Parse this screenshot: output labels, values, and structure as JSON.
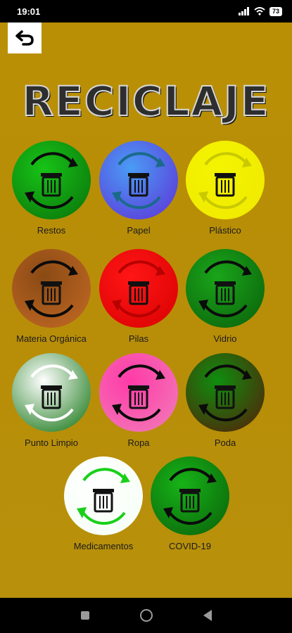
{
  "status_bar": {
    "time": "19:01",
    "battery": "73"
  },
  "header": {
    "title": "RECICLAJE"
  },
  "categories": [
    {
      "label": "Restos",
      "colors": [
        "#17c317",
        "#0a6f0a"
      ],
      "ring": "#0b0b0b",
      "icon": "trash-bin-icon"
    },
    {
      "label": "Papel",
      "colors": [
        "#4a9cf5",
        "#5f2fd6"
      ],
      "ring": "#1a6a8a",
      "icon": "paper-icon"
    },
    {
      "label": "Plástico",
      "colors": [
        "#f4f400",
        "#f0e800"
      ],
      "ring": "#c9c900",
      "icon": "plastic-icon"
    },
    {
      "label": "Materia Orgánica",
      "colors": [
        "#8a4a14",
        "#c56a25"
      ],
      "ring": "#0b0b0b",
      "icon": "organic-icon"
    },
    {
      "label": "Pilas",
      "colors": [
        "#ff1616",
        "#d80000"
      ],
      "ring": "#b80000",
      "icon": "battery-icon"
    },
    {
      "label": "Vidrio",
      "colors": [
        "#1aa51a",
        "#0a5e0a"
      ],
      "ring": "#0b0b0b",
      "icon": "glass-icon"
    },
    {
      "label": "Punto Limpio",
      "colors": [
        "#ffffff",
        "#0a6f0a"
      ],
      "ring": "#ffffff",
      "icon": "clean-point-icon"
    },
    {
      "label": "Ropa",
      "colors": [
        "#ff3aa8",
        "#f07fb8"
      ],
      "ring": "#0b0b0b",
      "icon": "clothes-icon"
    },
    {
      "label": "Poda",
      "colors": [
        "#0e8e0e",
        "#5a1a0a"
      ],
      "ring": "#0b0b0b",
      "icon": "pruning-icon"
    },
    {
      "label": "Medicamentos",
      "colors": [
        "#ffffff",
        "#f4fff4"
      ],
      "ring": "#19d019",
      "icon": "medicine-icon"
    },
    {
      "label": "COVID-19",
      "colors": [
        "#17b317",
        "#0a5e0a"
      ],
      "ring": "#0b0b0b",
      "icon": "mask-icon"
    }
  ]
}
